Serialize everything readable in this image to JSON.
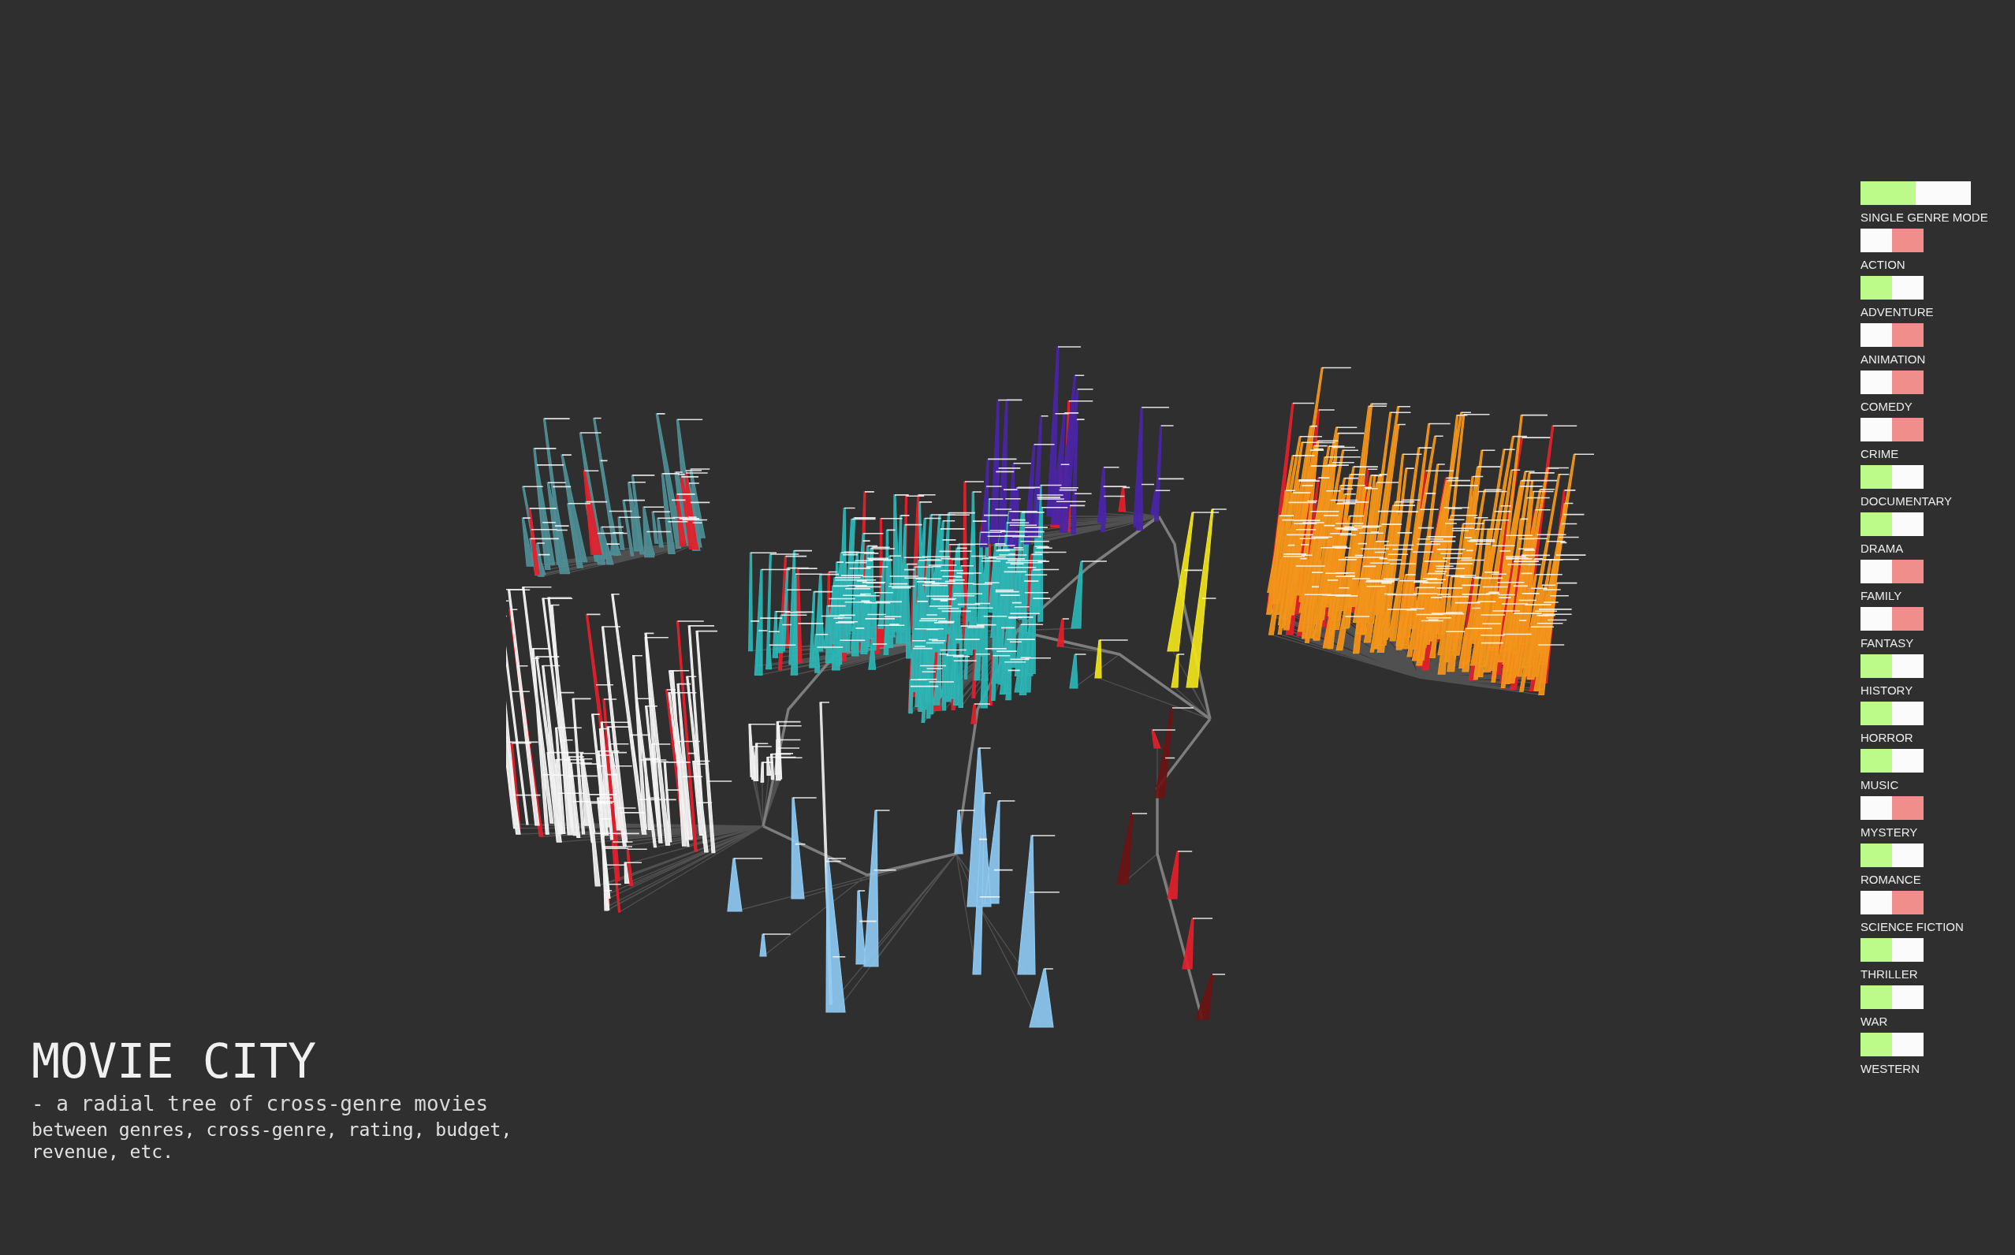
{
  "title": "MOVIE CITY",
  "subtitle": "- a radial tree of cross-genre movies",
  "description": "between genres, cross-genre, rating, budget, revenue, etc.",
  "mode_toggle": {
    "label": "SINGLE GENRE MODE",
    "on": true
  },
  "genres": [
    {
      "label": "ACTION",
      "on": false
    },
    {
      "label": "ADVENTURE",
      "on": true
    },
    {
      "label": "ANIMATION",
      "on": false
    },
    {
      "label": "COMEDY",
      "on": false
    },
    {
      "label": "CRIME",
      "on": false
    },
    {
      "label": "DOCUMENTARY",
      "on": true
    },
    {
      "label": "DRAMA",
      "on": true
    },
    {
      "label": "FAMILY",
      "on": false
    },
    {
      "label": "FANTASY",
      "on": false
    },
    {
      "label": "HISTORY",
      "on": true
    },
    {
      "label": "HORROR",
      "on": true
    },
    {
      "label": "MUSIC",
      "on": true
    },
    {
      "label": "MYSTERY",
      "on": false
    },
    {
      "label": "ROMANCE",
      "on": true
    },
    {
      "label": "SCIENCE FICTION",
      "on": false
    },
    {
      "label": "THRILLER",
      "on": true
    },
    {
      "label": "WAR",
      "on": true
    },
    {
      "label": "WESTERN",
      "on": true
    }
  ]
}
